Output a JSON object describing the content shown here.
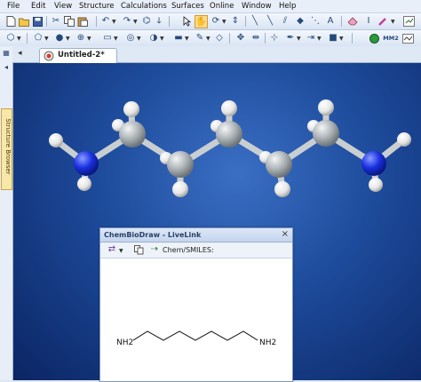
{
  "menu": [
    "File",
    "Edit",
    "View",
    "Structure",
    "Calculations",
    "Surfaces",
    "Online",
    "Window",
    "Help"
  ],
  "icons": {
    "toolbar1": [
      "new-file-icon",
      "open-file-icon",
      "save-icon",
      "cut-icon",
      "copy-icon",
      "paste-icon",
      "undo-icon",
      "redo-icon",
      "select-arrow-icon",
      "hand-icon",
      "rotate-icon",
      "translate-icon",
      "bond-tool-icon",
      "single-bond-icon",
      "double-bond-icon",
      "triple-bond-icon",
      "eraser-icon",
      "text-icon",
      "color-icon",
      "browser-icon"
    ],
    "toolbar2": [
      "ring-icon",
      "atom-style-icon",
      "stick-style-icon",
      "ball-stick-icon",
      "cylinder-icon",
      "wire-icon",
      "surface-icon",
      "label-icon",
      "measure-icon",
      "align-icon",
      "move-icon",
      "center-icon",
      "clip-icon",
      "plane-icon",
      "fit-icon",
      "color-atom-icon",
      "stop-icon",
      "mm2-icon",
      "minimize-icon"
    ]
  },
  "toolbar2_mm2_label": "MM2",
  "side_panel": {
    "label": "Structure Browser"
  },
  "document_tab": {
    "label": "Untitled-2*"
  },
  "livelink": {
    "title": "ChemBioDraw - LiveLink",
    "close": "×",
    "smiles_label": "Chem/SMILES:",
    "molecule": {
      "left_label": "NH2",
      "right_label": "NH2"
    }
  },
  "colors": {
    "canvas_bg": "#1d4a9a",
    "carbon": "#9aa2a6",
    "hydrogen": "#f2f2f2",
    "nitrogen": "#1930e0",
    "tab_accent": "#d23b2a"
  }
}
